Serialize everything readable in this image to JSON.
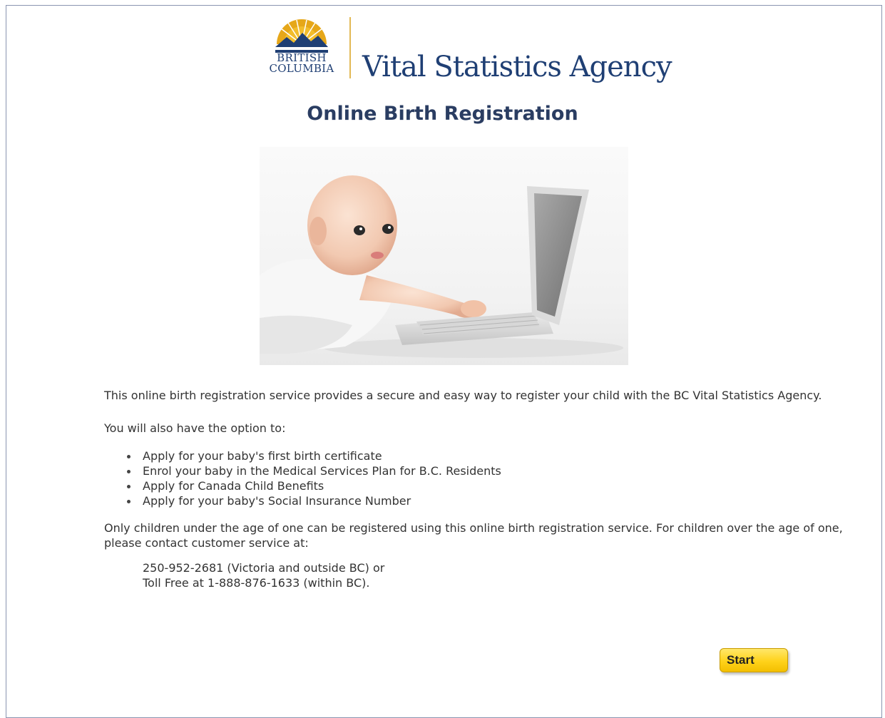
{
  "header": {
    "logo_line1": "BRITISH",
    "logo_line2": "COLUMBIA",
    "agency_name": "Vital Statistics Agency"
  },
  "page_title": "Online Birth Registration",
  "content": {
    "intro": "This online birth registration service provides a secure and easy way to register your child with the BC Vital Statistics Agency.",
    "option_lead": "You will also have the option to:",
    "options": [
      "Apply for your baby's first birth certificate",
      "Enrol your baby in the Medical Services Plan for B.C. Residents",
      "Apply for Canada Child Benefits",
      "Apply for your baby's Social Insurance Number"
    ],
    "notice": "Only children under the age of one can be registered using this online birth registration service. For children over the age of one, please contact customer service at:",
    "contact_line1": "250-952-2681 (Victoria and outside BC) or",
    "contact_line2": "Toll Free at 1-888-876-1633 (within BC)."
  },
  "start_button": {
    "label": "Start"
  },
  "colors": {
    "brand_navy": "#1f3f74",
    "title": "#2a3d62",
    "button_yellow": "#ffd21a",
    "logo_gold": "#e2b955"
  }
}
